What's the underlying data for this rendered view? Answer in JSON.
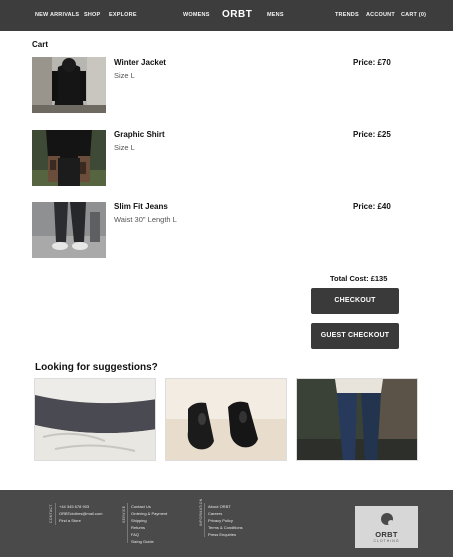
{
  "header": {
    "nav_left": [
      "NEW ARRIVALS",
      "SHOP",
      "EXPLORE"
    ],
    "nav_center_left": "WOMENS",
    "logo": "ORBT",
    "nav_center_right": "MENS",
    "nav_right": [
      "TRENDS",
      "ACCOUNT",
      "CART (0)"
    ]
  },
  "cart": {
    "title": "Cart",
    "items": [
      {
        "name": "Winter Jacket",
        "size": "Size L",
        "price": "Price: £70"
      },
      {
        "name": "Graphic Shirt",
        "size": "Size L",
        "price": "Price: £25"
      },
      {
        "name": "Slim Fit Jeans",
        "size": "Waist 30\" Length L",
        "price": "Price: £40"
      }
    ],
    "total": "Total Cost: £135",
    "checkout_label": "CHECKOUT",
    "guest_checkout_label": "GUEST CHECKOUT"
  },
  "suggestions": {
    "title": "Looking for suggestions?"
  },
  "footer": {
    "contact_label": "CONTACT",
    "contact": [
      "+44 345 678 903",
      "ORBTclothes@mail.com",
      "Find a Store"
    ],
    "service_label": "SERVICE",
    "service": [
      "Contact Us",
      "Ordering & Payment",
      "Shipping",
      "Returns",
      "FAQ",
      "Sizing Guide"
    ],
    "info_label": "INFORMATION",
    "info": [
      "About ORBT",
      "Careers",
      "Privacy Policy",
      "Terms & Conditions",
      "Press Enquiries"
    ],
    "logo": "ORBT",
    "logo_sub": "CLOTHING"
  }
}
